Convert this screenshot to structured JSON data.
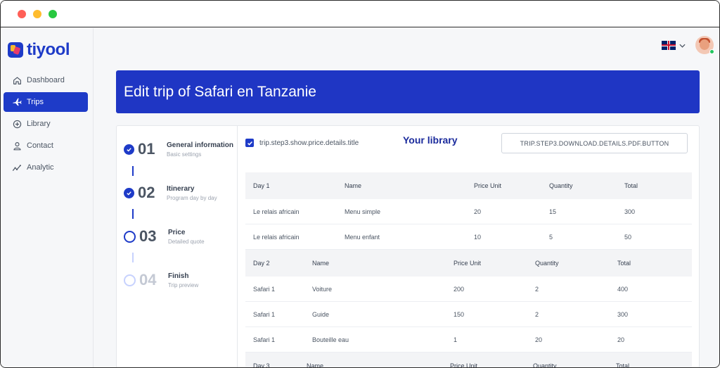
{
  "window": {
    "buttons": [
      "close",
      "minimize",
      "maximize"
    ]
  },
  "brand": {
    "name": "tiyool",
    "color": "#1e3bc8"
  },
  "nav": [
    {
      "label": "Dashboard",
      "icon": "home-icon",
      "active": false
    },
    {
      "label": "Trips",
      "icon": "plane-icon",
      "active": true
    },
    {
      "label": "Library",
      "icon": "plus-circle-icon",
      "active": false
    },
    {
      "label": "Contact",
      "icon": "user-icon",
      "active": false
    },
    {
      "label": "Analytic",
      "icon": "chart-line-icon",
      "active": false
    }
  ],
  "header": {
    "title": "Edit trip of Safari en Tanzanie"
  },
  "steps": [
    {
      "num": "01",
      "title": "General information",
      "subtitle": "Basic settings",
      "state": "done"
    },
    {
      "num": "02",
      "title": "Itinerary",
      "subtitle": "Program day by day",
      "state": "done"
    },
    {
      "num": "03",
      "title": "Price",
      "subtitle": "Detailed quote",
      "state": "current"
    },
    {
      "num": "04",
      "title": "Finish",
      "subtitle": "Trip preview",
      "state": "pending"
    }
  ],
  "content": {
    "checkbox_label": "trip.step3.show.price.details.title",
    "download_button": "TRIP.STEP3.DOWNLOAD.DETAILS.PDF.BUTTON",
    "library_overlay": "Your library"
  },
  "price_table": {
    "days": [
      {
        "headers": [
          "Day 1",
          "Name",
          "Price Unit",
          "Quantity",
          "Total"
        ],
        "rows": [
          [
            "Le relais africain",
            "Menu simple",
            "20",
            "15",
            "300"
          ],
          [
            "Le relais africain",
            "Menu enfant",
            "10",
            "5",
            "50"
          ]
        ]
      },
      {
        "headers": [
          "Day 2",
          "Name",
          "Price Unit",
          "Quantity",
          "Total"
        ],
        "rows": [
          [
            "Safari 1",
            "Voiture",
            "200",
            "2",
            "400"
          ],
          [
            "Safari 1",
            "Guide",
            "150",
            "2",
            "300"
          ],
          [
            "Safari 1",
            "Bouteille eau",
            "1",
            "20",
            "20"
          ]
        ]
      },
      {
        "headers": [
          "Day 3",
          "Name",
          "Price Unit",
          "Quantity",
          "Total"
        ],
        "rows": []
      }
    ]
  }
}
